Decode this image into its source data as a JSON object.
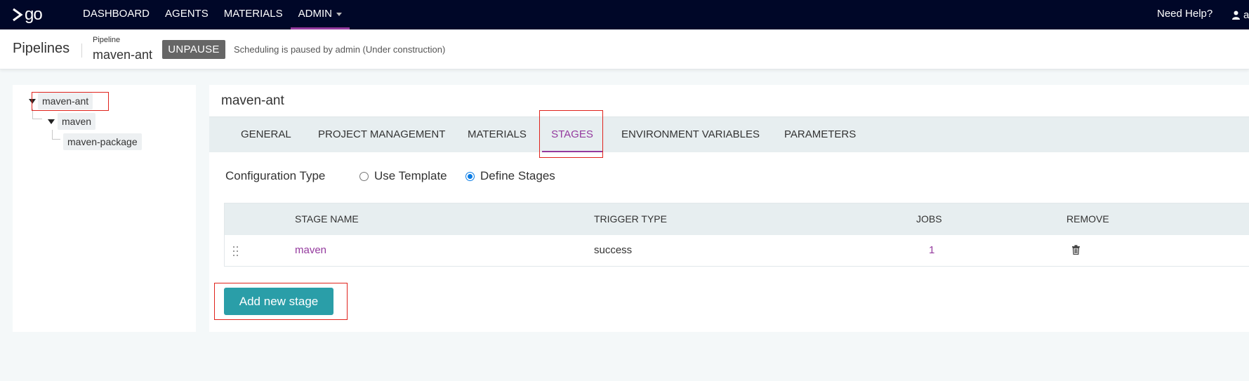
{
  "topnav": {
    "logo_text": "go",
    "items": [
      {
        "label": "DASHBOARD"
      },
      {
        "label": "AGENTS"
      },
      {
        "label": "MATERIALS"
      },
      {
        "label": "ADMIN"
      }
    ],
    "need_help": "Need Help?",
    "user_label": "a",
    "active_color": "#943a9e",
    "background": "#000728"
  },
  "header": {
    "title": "Pipelines",
    "crumb_label": "Pipeline",
    "crumb_value": "maven-ant",
    "unpause_label": "UNPAUSE",
    "pause_message": "Scheduling is paused by admin (Under construction)"
  },
  "tree": {
    "pipeline": "maven-ant",
    "stage": "maven",
    "job": "maven-package"
  },
  "main": {
    "pipeline_name": "maven-ant",
    "tabs": [
      {
        "label": "GENERAL"
      },
      {
        "label": "PROJECT MANAGEMENT"
      },
      {
        "label": "MATERIALS"
      },
      {
        "label": "STAGES"
      },
      {
        "label": "ENVIRONMENT VARIABLES"
      },
      {
        "label": "PARAMETERS"
      }
    ],
    "active_tab": "STAGES",
    "config": {
      "label": "Configuration Type",
      "options": [
        {
          "label": "Use Template",
          "checked": false
        },
        {
          "label": "Define Stages",
          "checked": true
        }
      ]
    },
    "table": {
      "headers": [
        "STAGE NAME",
        "TRIGGER TYPE",
        "JOBS",
        "REMOVE"
      ],
      "rows": [
        {
          "stage_name": "maven",
          "trigger_type": "success",
          "jobs": "1",
          "remove_icon": "trash-icon"
        }
      ]
    },
    "add_stage_label": "Add new stage",
    "accent_color": "#2a9ea8"
  }
}
